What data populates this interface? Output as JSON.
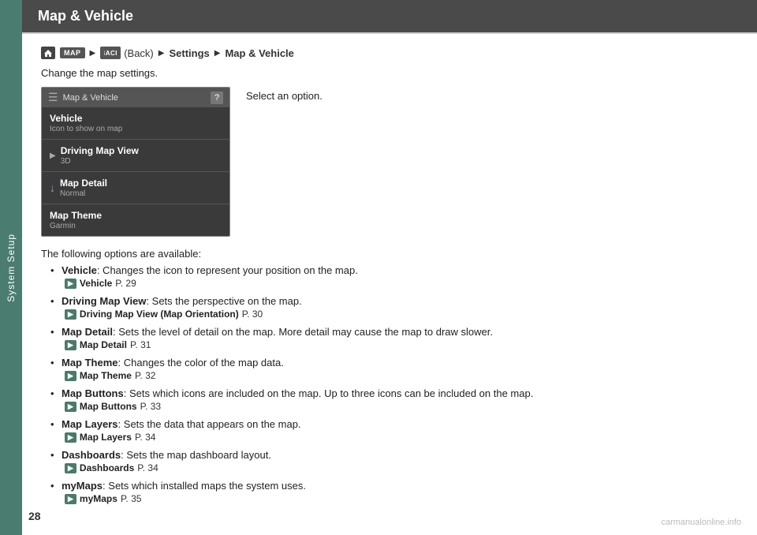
{
  "sidebar": {
    "label": "System Setup"
  },
  "header": {
    "title": "Map & Vehicle"
  },
  "nav": {
    "home_icon_text": "⌂",
    "map_button": "MAP",
    "back_button": "BACK",
    "back_label": "(Back)",
    "arrow": "▶",
    "settings": "Settings",
    "page_title": "Map & Vehicle"
  },
  "intro": "Change the map settings.",
  "menu_box": {
    "header_label": "Map & Vehicle",
    "question": "?",
    "items": [
      {
        "title": "Vehicle",
        "sub": "Icon to show on map",
        "active": false,
        "has_chevron": false
      },
      {
        "title": "Driving Map View",
        "sub": "3D",
        "active": false,
        "has_chevron": true
      },
      {
        "title": "Map Detail",
        "sub": "Normal",
        "active": false,
        "has_arrow": true
      },
      {
        "title": "Map Theme",
        "sub": "Garmin",
        "active": false,
        "has_chevron": false
      }
    ]
  },
  "select_option": "Select an option.",
  "following_text": "The following options are available:",
  "options": [
    {
      "term": "Vehicle",
      "colon": ":",
      "desc": " Changes the icon to represent your position on the map.",
      "ref_label": "Vehicle",
      "ref_page": "P. 29"
    },
    {
      "term": "Driving Map View",
      "colon": ":",
      "desc": " Sets the perspective on the map.",
      "ref_label": "Driving Map View (Map Orientation)",
      "ref_page": "P. 30"
    },
    {
      "term": "Map Detail",
      "colon": ":",
      "desc": " Sets the level of detail on the map. More detail may cause the map to draw slower.",
      "ref_label": "Map Detail",
      "ref_page": "P. 31"
    },
    {
      "term": "Map Theme",
      "colon": ":",
      "desc": " Changes the color of the map data.",
      "ref_label": "Map Theme",
      "ref_page": "P. 32"
    },
    {
      "term": "Map Buttons",
      "colon": ":",
      "desc": " Sets which icons are included on the map. Up to three icons can be included on the map.",
      "ref_label": "Map Buttons",
      "ref_page": "P. 33"
    },
    {
      "term": "Map Layers",
      "colon": ":",
      "desc": " Sets the data that appears on the map.",
      "ref_label": "Map Layers",
      "ref_page": "P. 34"
    },
    {
      "term": "Dashboards",
      "colon": ":",
      "desc": " Sets the map dashboard layout.",
      "ref_label": "Dashboards",
      "ref_page": "P. 34"
    },
    {
      "term": "myMaps",
      "colon": ":",
      "desc": " Sets which installed maps the system uses.",
      "ref_label": "myMaps",
      "ref_page": "P. 35"
    }
  ],
  "page_number": "28",
  "watermark": "carmanualonline.info"
}
